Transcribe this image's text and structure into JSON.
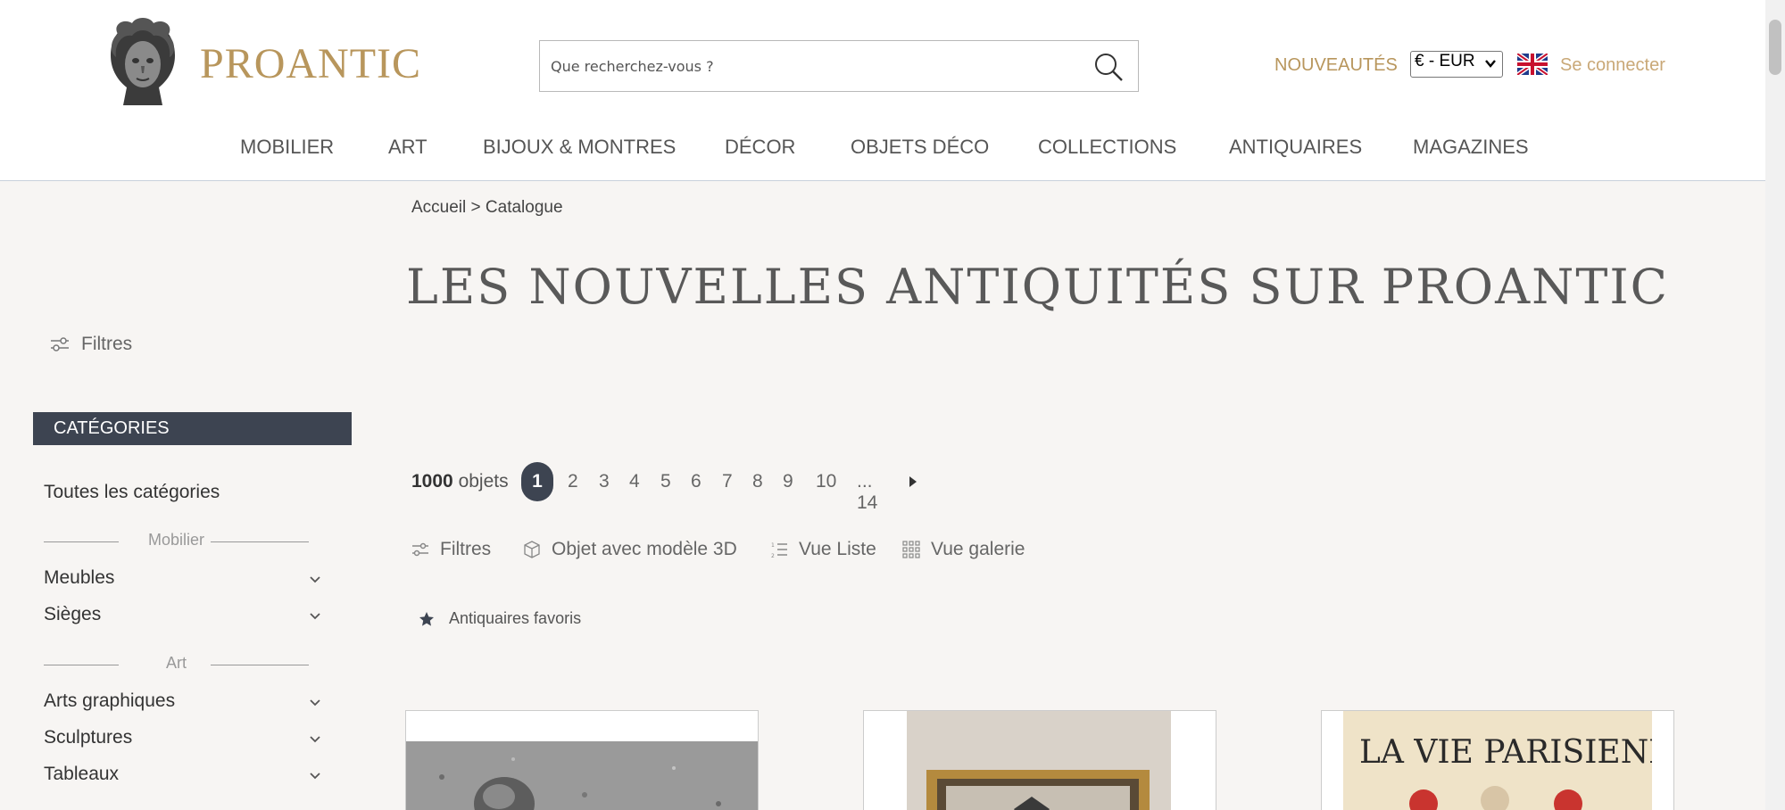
{
  "header": {
    "logo_text": "PROANTIC",
    "search": {
      "placeholder": "Que recherchez-vous ?",
      "value": ""
    },
    "nouveautes": "NOUVEAUTÉS",
    "currency": "€ - EUR",
    "login": "Se connecter"
  },
  "nav": {
    "items": [
      "MOBILIER",
      "ART",
      "BIJOUX & MONTRES",
      "DÉCOR",
      "OBJETS DÉCO",
      "COLLECTIONS",
      "ANTIQUAIRES",
      "MAGAZINES"
    ]
  },
  "breadcrumb": "Accueil > Catalogue",
  "page_title": "LES NOUVELLES ANTIQUITÉS SUR PROANTIC",
  "sidebar": {
    "filters_label": "Filtres",
    "categories_header": "CATÉGORIES",
    "all_categories": "Toutes les catégories",
    "group_mobilier": "Mobilier",
    "group_art": "Art",
    "items": [
      "Meubles",
      "Sièges",
      "Arts graphiques",
      "Sculptures",
      "Tableaux"
    ]
  },
  "results": {
    "count": "1000",
    "count_suffix": "objets",
    "pages": [
      "1",
      "2",
      "3",
      "4",
      "5",
      "6",
      "7",
      "8",
      "9",
      "10",
      "... 14"
    ]
  },
  "toolbar": {
    "filters": "Filtres",
    "model3d": "Objet avec modèle 3D",
    "list_view": "Vue Liste",
    "gallery_view": "Vue galerie"
  },
  "favorites_label": "Antiquaires favoris",
  "cards": [
    {
      "image": "gray-garden-object-photo"
    },
    {
      "image": "framed-artwork-photo"
    },
    {
      "image": "vintage-poster-photo",
      "poster_text": "LA VIE PARISIENNE"
    }
  ],
  "colors": {
    "brand_gold": "#b8965c",
    "dark_slate": "#3d4451",
    "page_bg": "#f7f5f3"
  }
}
